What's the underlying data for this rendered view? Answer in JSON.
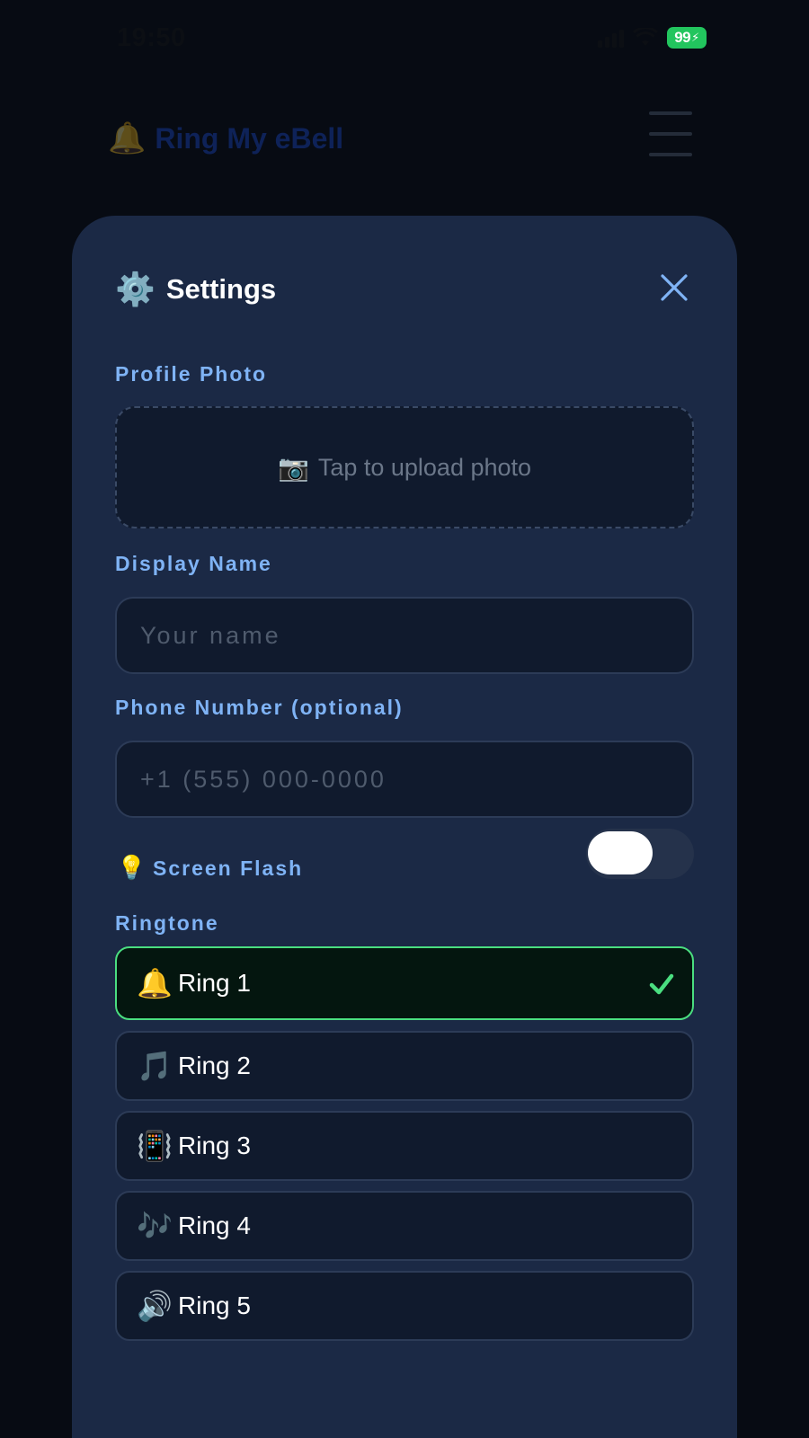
{
  "status_bar": {
    "time": "19:50",
    "battery": "99",
    "icons": [
      "signal-icon",
      "wifi-icon",
      "battery-charging-icon"
    ]
  },
  "app": {
    "brand_emoji": "🔔",
    "brand_name": "Ring My eBell",
    "menu_icon": "hamburger-menu-icon"
  },
  "settings": {
    "gear_emoji": "⚙️",
    "title": "Settings",
    "close_icon": "close-x-icon",
    "profile_photo": {
      "label": "Profile Photo",
      "camera_emoji": "📷",
      "upload_text": "Tap to upload photo"
    },
    "display_name": {
      "label": "Display Name",
      "placeholder": "Your name",
      "value": ""
    },
    "phone": {
      "label": "Phone Number (optional)",
      "placeholder": "+1 (555) 000-0000",
      "value": ""
    },
    "screen_flash": {
      "emoji": "💡",
      "label": "Screen Flash",
      "enabled": false
    },
    "ringtone": {
      "label": "Ringtone",
      "selected": "Ring 1",
      "options": [
        {
          "emoji": "🔔",
          "label": "Ring 1",
          "selected": true
        },
        {
          "emoji": "🎵",
          "label": "Ring 2",
          "selected": false
        },
        {
          "emoji": "📳",
          "label": "Ring 3",
          "selected": false
        },
        {
          "emoji": "🎶",
          "label": "Ring 4",
          "selected": false
        },
        {
          "emoji": "🔊",
          "label": "Ring 5",
          "selected": false
        }
      ]
    }
  },
  "colors": {
    "sheet_background": "#1b2945",
    "label_blue": "#7fb3f5",
    "selected_green": "#4ade80",
    "battery_green": "#22c55e"
  }
}
